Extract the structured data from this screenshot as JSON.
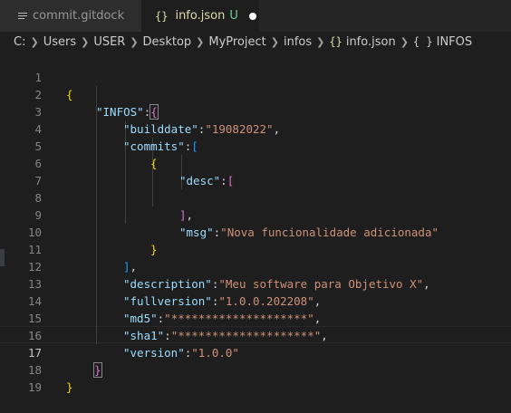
{
  "tabs": [
    {
      "label": "commit.gitdock",
      "icon": "lines-file-icon",
      "active": false
    },
    {
      "label": "info.json",
      "status": "U",
      "icon": "json-braces-icon",
      "active": true,
      "dirty": true
    }
  ],
  "breadcrumb": {
    "segments": [
      "C:",
      "Users",
      "USER",
      "Desktop",
      "MyProject",
      "infos",
      "info.json",
      "INFOS"
    ],
    "braces_icon": "{}",
    "object_icon": "{ }"
  },
  "editor": {
    "active_line": 17,
    "line_numbers": [
      "1",
      "2",
      "3",
      "4",
      "5",
      "6",
      "7",
      "8",
      "9",
      "10",
      "11",
      "12",
      "13",
      "14",
      "15",
      "16",
      "17",
      "18",
      "19"
    ],
    "code": {
      "l1_open": "{",
      "l2_key": "\"INFOS\"",
      "l2_colon": ":",
      "l2_open": "{",
      "l3_key": "\"builddate\"",
      "l3_colon": ":",
      "l3_val": "\"19082022\"",
      "l3_comma": ",",
      "l4_key": "\"commits\"",
      "l4_colon": ":",
      "l4_open": "[",
      "l5_open": "{",
      "l6_key": "\"desc\"",
      "l6_colon": ":",
      "l6_open": "[",
      "l8_close": "]",
      "l8_comma": ",",
      "l9_key": "\"msg\"",
      "l9_colon": ":",
      "l9_val": "\"Nova funcionalidade adicionada\"",
      "l10_close": "}",
      "l11_close": "]",
      "l11_comma": ",",
      "l12_key": "\"description\"",
      "l12_colon": ":",
      "l12_val": "\"Meu software para Objetivo X\"",
      "l12_comma": ",",
      "l13_key": "\"fullversion\"",
      "l13_colon": ":",
      "l13_val": "\"1.0.0.202208\"",
      "l13_comma": ",",
      "l14_key": "\"md5\"",
      "l14_colon": ":",
      "l14_val": "\"********************\"",
      "l14_comma": ",",
      "l15_key": "\"sha1\"",
      "l15_colon": ":",
      "l15_val": "\"********************\"",
      "l15_comma": ",",
      "l16_key": "\"version\"",
      "l16_colon": ":",
      "l16_val": "\"1.0.0\"",
      "l17_close": "}",
      "l18_close": "}"
    }
  },
  "colors": {
    "bracket_level1": "#ffd700",
    "bracket_level2": "#da70d6",
    "bracket_level3": "#179fff",
    "key": "#9cdcfe",
    "string": "#ce9178",
    "untracked_status": "#73c991"
  }
}
